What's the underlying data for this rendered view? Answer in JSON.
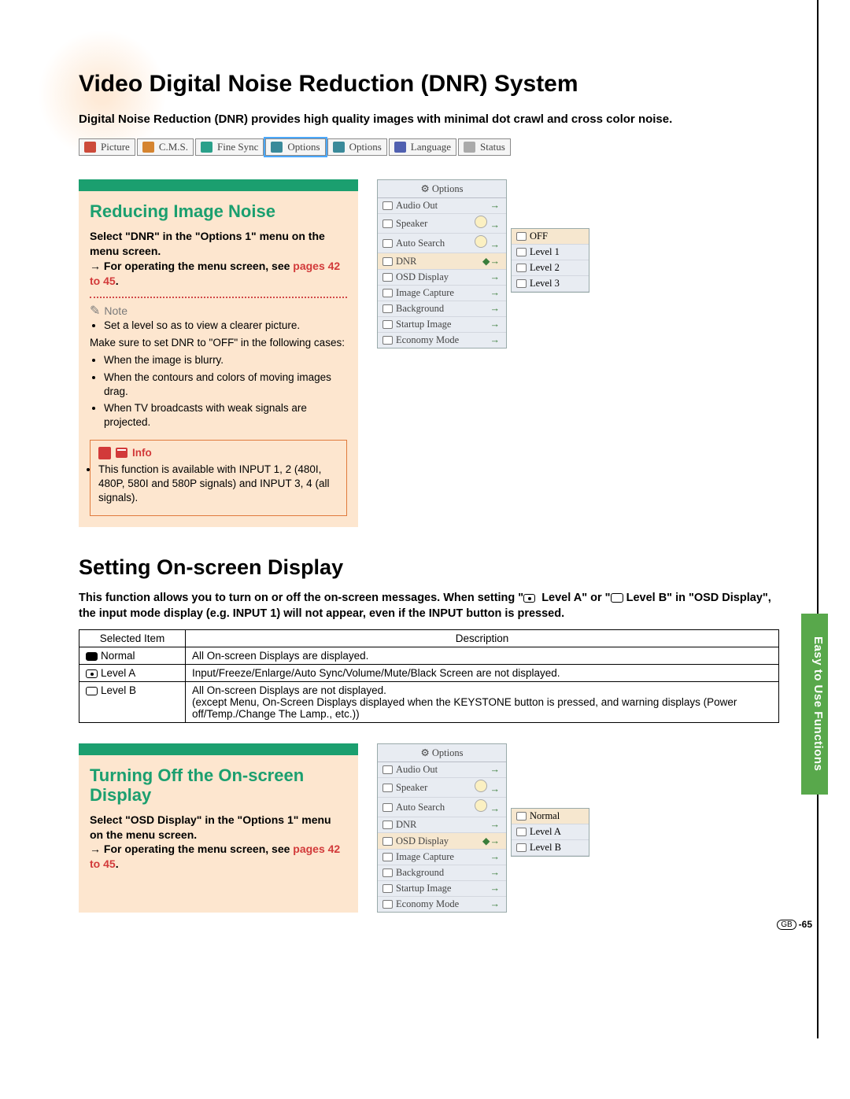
{
  "headings": {
    "h1": "Video Digital Noise Reduction (DNR) System",
    "h2": "Setting On-screen Display"
  },
  "intro1": "Digital Noise Reduction (DNR) provides high quality images with minimal dot crawl and cross color noise.",
  "menubar": [
    {
      "label": "Picture",
      "color": "mi-red"
    },
    {
      "label": "C.M.S.",
      "color": "mi-orange"
    },
    {
      "label": "Fine Sync",
      "color": "mi-teal1"
    },
    {
      "label": "Options",
      "color": "mi-teal2",
      "active": true
    },
    {
      "label": "Options",
      "color": "mi-teal2"
    },
    {
      "label": "Language",
      "color": "mi-blue"
    },
    {
      "label": "Status",
      "color": "mi-grey"
    }
  ],
  "section1": {
    "title": "Reducing Image Noise",
    "instr1": "Select \"DNR\" in the \"Options 1\" menu on the menu screen.",
    "instr2_pre": "→ For operating the menu screen, see ",
    "instr2_link": "pages 42 to 45",
    "note_label": "Note",
    "note_bullets_a": "Set a level so as to view a clearer picture.",
    "note_para": "Make sure to set DNR to \"OFF\" in the following cases:",
    "note_bullets_b": [
      "When the image is blurry.",
      "When the contours and colors of moving images drag.",
      "When TV broadcasts with weak signals are projected."
    ],
    "info_label": "Info",
    "info_bullets": [
      "This function is available with INPUT 1, 2 (480I, 480P, 580I and 580P signals) and INPUT 3, 4 (all signals)."
    ]
  },
  "osd1": {
    "title": "Options",
    "rows": [
      {
        "label": "Audio Out"
      },
      {
        "label": "Speaker",
        "pill": true
      },
      {
        "label": "Auto Search",
        "pill": true
      },
      {
        "label": "DNR",
        "hl": true
      },
      {
        "label": "OSD Display"
      },
      {
        "label": "Image Capture"
      },
      {
        "label": "Background"
      },
      {
        "label": "Startup Image"
      },
      {
        "label": "Economy Mode"
      }
    ],
    "sub": [
      {
        "label": "OFF",
        "hl": true
      },
      {
        "label": "Level 1"
      },
      {
        "label": "Level 2"
      },
      {
        "label": "Level 3"
      }
    ]
  },
  "intro2_a": "This function allows you to turn on or off the on-screen messages. When setting \"",
  "intro2_b": " Level A\" or \"",
  "intro2_c": " Level B\" in \"OSD Display\", the input mode display (e.g. INPUT 1) will not appear, even if the INPUT button is pressed.",
  "table": {
    "h1": "Selected Item",
    "h2": "Description",
    "rows": [
      {
        "item": "Normal",
        "desc": "All On-screen Displays are displayed."
      },
      {
        "item": "Level A",
        "desc": "Input/Freeze/Enlarge/Auto Sync/Volume/Mute/Black Screen are not displayed."
      },
      {
        "item": "Level B",
        "desc": "All On-screen Displays are not displayed.\n(except Menu, On-Screen Displays displayed when the KEYSTONE button is pressed, and warning displays (Power off/Temp./Change The Lamp., etc.))"
      }
    ]
  },
  "section2": {
    "title": "Turning Off the On-screen Display",
    "instr1": "Select \"OSD Display\" in the \"Options 1\" menu on the menu screen.",
    "instr2_pre": "→ For operating the menu screen, see ",
    "instr2_link": "pages 42 to 45"
  },
  "osd2": {
    "title": "Options",
    "rows": [
      {
        "label": "Audio Out"
      },
      {
        "label": "Speaker",
        "pill": true
      },
      {
        "label": "Auto Search",
        "pill": true
      },
      {
        "label": "DNR"
      },
      {
        "label": "OSD Display",
        "hl": true
      },
      {
        "label": "Image Capture"
      },
      {
        "label": "Background"
      },
      {
        "label": "Startup Image"
      },
      {
        "label": "Economy Mode"
      }
    ],
    "sub": [
      {
        "label": "Normal",
        "hl": true
      },
      {
        "label": "Level A"
      },
      {
        "label": "Level B"
      }
    ]
  },
  "sidetab": "Easy to Use Functions",
  "pageno": {
    "prefix": "GB",
    "num": "-65"
  }
}
